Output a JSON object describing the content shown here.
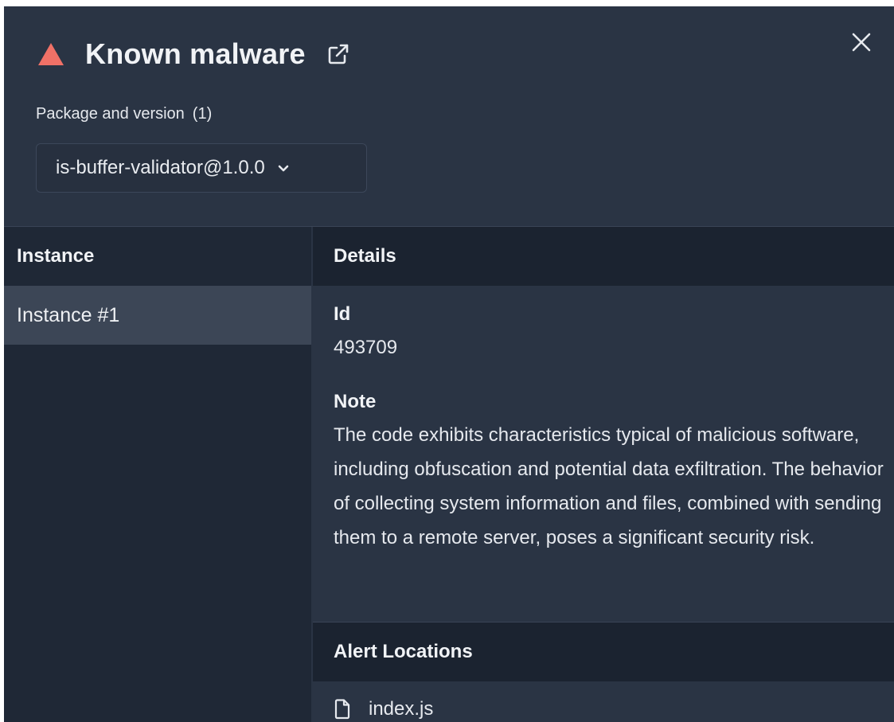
{
  "colors": {
    "warning": "#f07167",
    "panel_bg": "#2a3444",
    "header_band": "#1b2330",
    "selected_row": "#3c4656"
  },
  "header": {
    "title": "Known malware",
    "title_icon": "warning-triangle-icon",
    "external_link_icon": "external-link-icon",
    "close_icon": "close-icon"
  },
  "package": {
    "label": "Package and version",
    "count": "(1)",
    "selected": "is-buffer-validator@1.0.0"
  },
  "instances": {
    "header": "Instance",
    "items": [
      {
        "label": "Instance #1"
      }
    ]
  },
  "details": {
    "header": "Details",
    "id_label": "Id",
    "id_value": "493709",
    "note_label": "Note",
    "note_value": "The code exhibits characteristics typical of malicious software, including obfuscation and potential data exfiltration. The behavior of collecting system information and files, combined with sending them to a remote server, poses a significant security risk."
  },
  "alert_locations": {
    "header": "Alert Locations",
    "files": [
      {
        "name": "index.js",
        "icon": "file-icon"
      }
    ]
  }
}
